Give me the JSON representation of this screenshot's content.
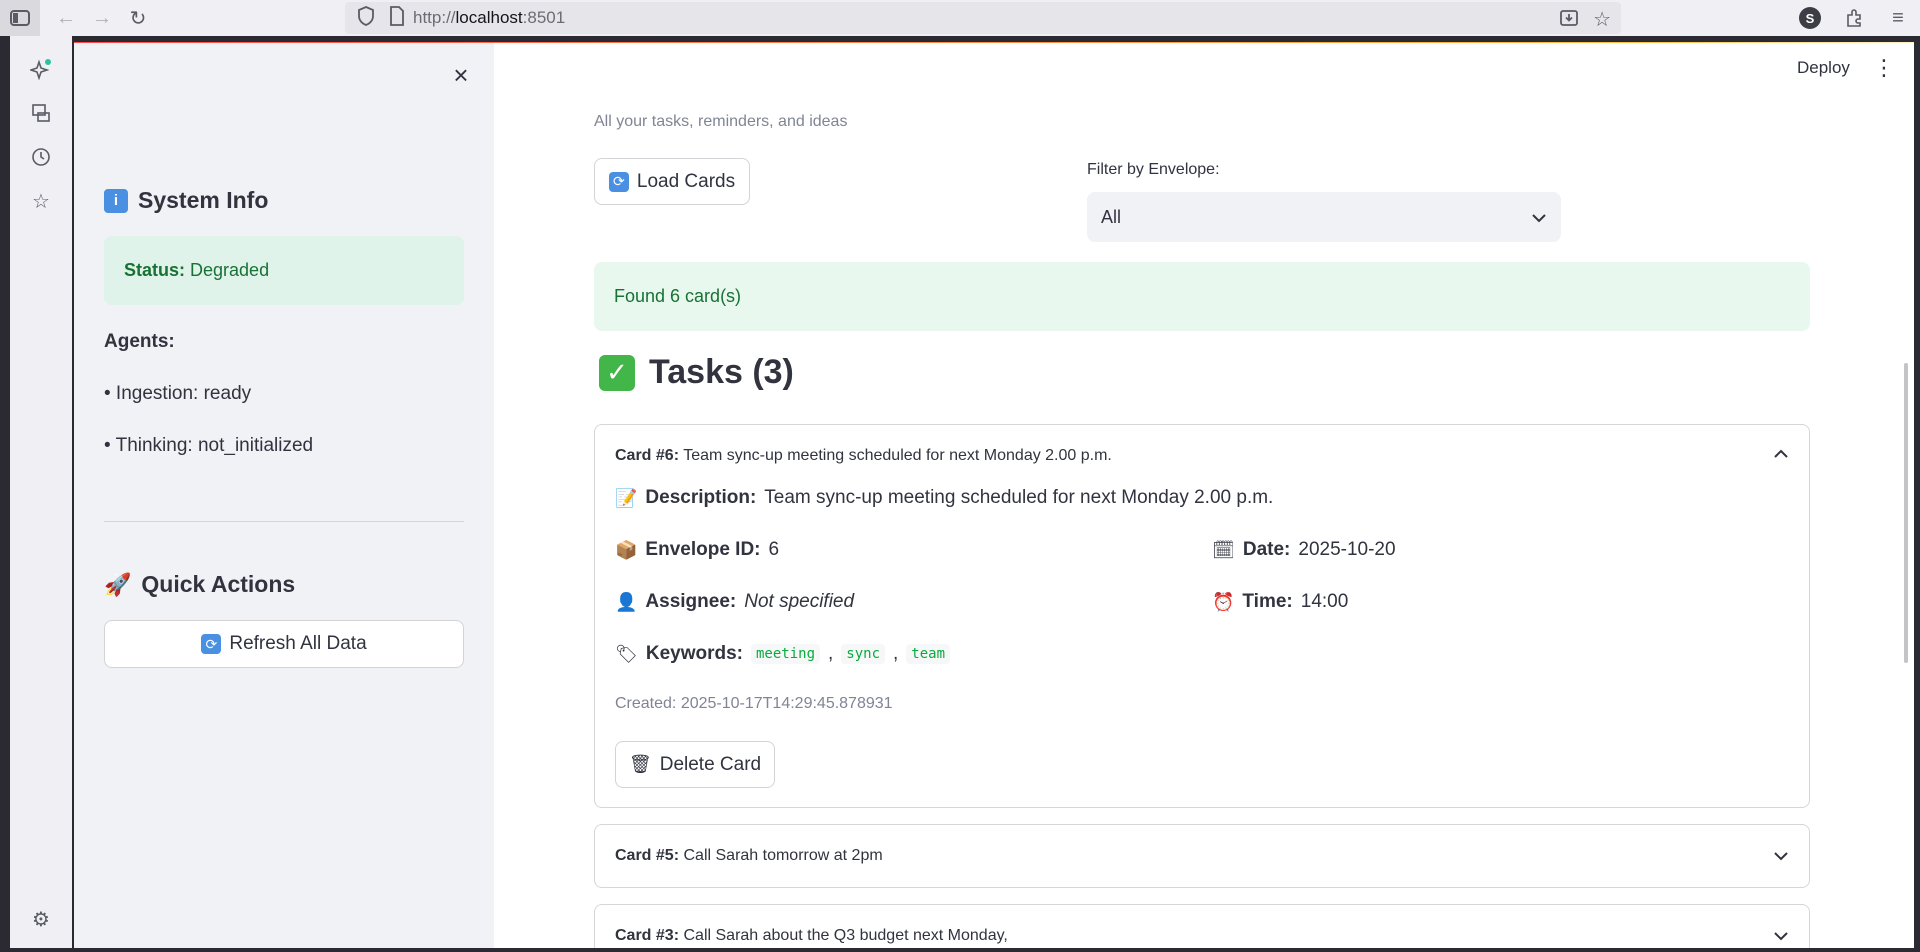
{
  "browser": {
    "url_prefix": "http://",
    "url_host": "localhost",
    "url_port": ":8501",
    "profile_initial": "S"
  },
  "header": {
    "deploy_label": "Deploy"
  },
  "sidebar": {
    "system_info_title": "System Info",
    "status_label": "Status:",
    "status_value": "Degraded",
    "agents_label": "Agents:",
    "agents": [
      "• Ingestion: ready",
      "• Thinking: not_initialized"
    ],
    "quick_actions_title": "Quick Actions",
    "refresh_label": "Refresh All Data"
  },
  "main": {
    "caption": "All your tasks, reminders, and ideas",
    "load_cards_label": "Load Cards",
    "filter_label": "Filter by Envelope:",
    "filter_value": "All",
    "found_message": "Found 6 card(s)",
    "tasks_heading": "Tasks (3)",
    "cards": [
      {
        "id_label": "Card #6:",
        "title": "Team sync-up meeting scheduled for next Monday 2.00 p.m.",
        "expanded": true,
        "description_label": "Description:",
        "description": "Team sync-up meeting scheduled for next Monday 2.00 p.m.",
        "envelope_label": "Envelope ID:",
        "envelope_id": "6",
        "date_label": "Date:",
        "date": "2025-10-20",
        "assignee_label": "Assignee:",
        "assignee": "Not specified",
        "time_label": "Time:",
        "time": "14:00",
        "keywords_label": "Keywords:",
        "keywords": [
          "meeting",
          "sync",
          "team"
        ],
        "created": "Created: 2025-10-17T14:29:45.878931",
        "delete_label": "Delete Card"
      },
      {
        "id_label": "Card #5:",
        "title": "Call Sarah tomorrow at 2pm",
        "expanded": false
      },
      {
        "id_label": "Card #3:",
        "title": "Call Sarah about the Q3 budget next Monday,",
        "expanded": false
      }
    ]
  },
  "colors": {
    "accent_red": "#ff4b4b",
    "success_text": "#177233",
    "success_bg": "#dff3ea"
  }
}
